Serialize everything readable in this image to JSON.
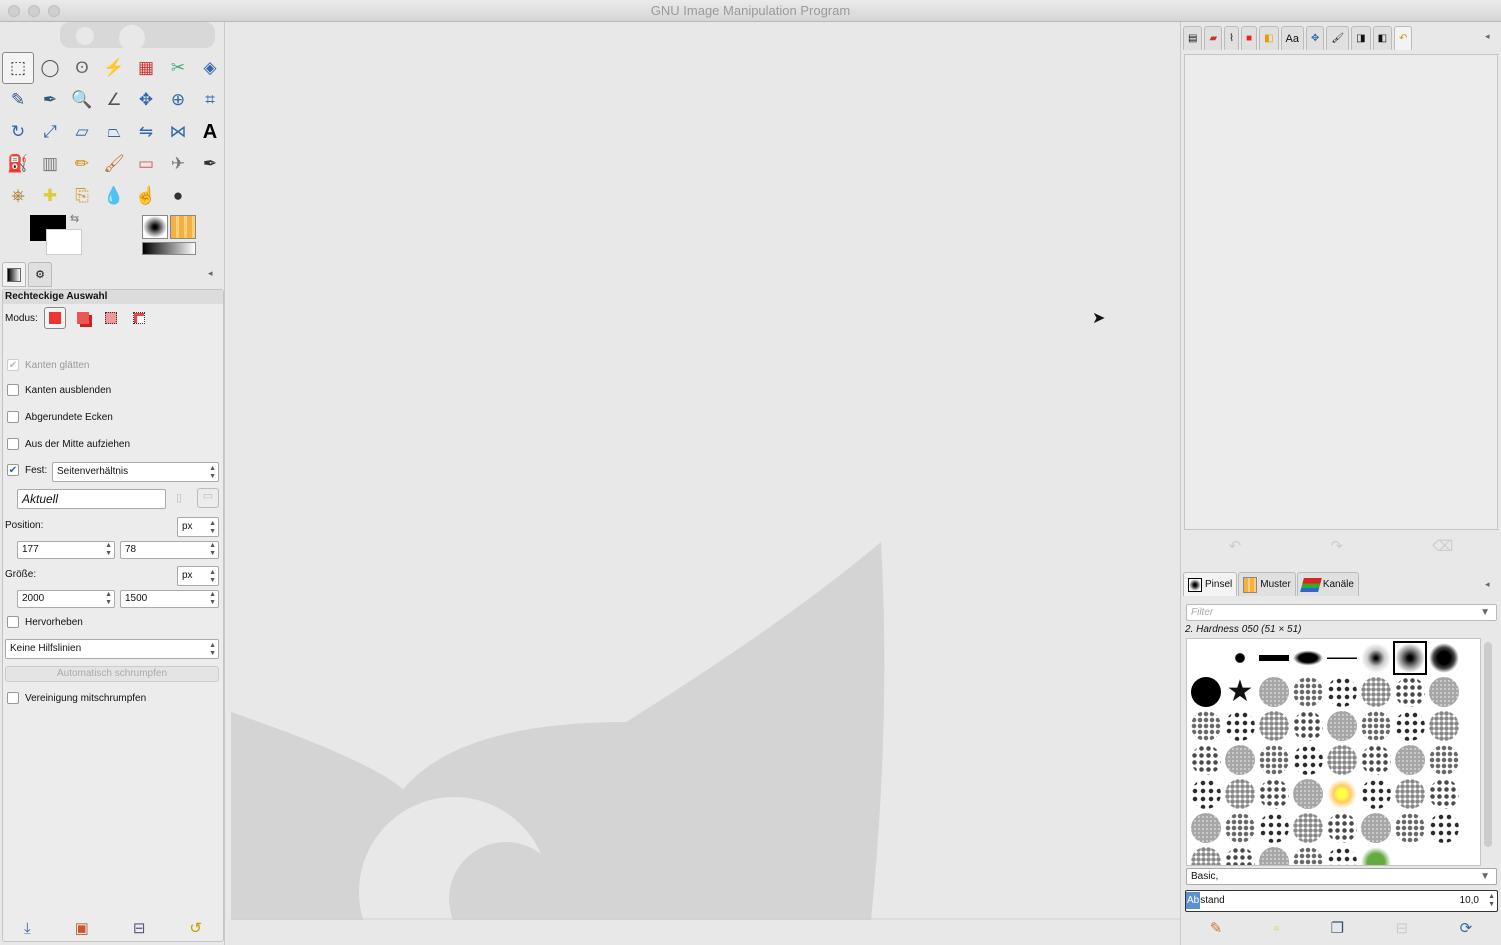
{
  "window": {
    "title": "GNU Image Manipulation Program"
  },
  "toolbox": {
    "tools": [
      "rect-select",
      "ellipse-select",
      "free-select",
      "fuzzy-select",
      "select-by-color",
      "scissors",
      "foreground-select",
      "paths",
      "color-picker",
      "zoom",
      "measure",
      "move",
      "align",
      "crop",
      "rotate",
      "scale",
      "shear",
      "perspective",
      "flip",
      "cage-transform",
      "text",
      "bucket-fill",
      "blend",
      "pencil",
      "paintbrush",
      "eraser",
      "airbrush",
      "ink",
      "clone",
      "heal",
      "perspective-clone",
      "blur",
      "smudge",
      "dodge-burn"
    ],
    "tool_glyphs": [
      "⬚",
      "◯",
      "ʘ",
      "⚡",
      "▦",
      "✂",
      "◈",
      "✎",
      "✒",
      "🔍",
      "∠",
      "✥",
      "⊕",
      "⌗",
      "↻",
      "⤢",
      "▱",
      "⏢",
      "⇋",
      "⋈",
      "A",
      "⛽",
      "▥",
      "✏",
      "🖌",
      "▭",
      "✈",
      "✒",
      "⎈",
      "✚",
      "⎘",
      "💧",
      "☝",
      "●"
    ],
    "tool_colors": [
      "#333",
      "#555",
      "#666",
      "#777",
      "#c33",
      "#4a7",
      "#36a",
      "#358",
      "#357",
      "#357",
      "#555",
      "#36a",
      "#36a",
      "#36a",
      "#36a",
      "#36a",
      "#36a",
      "#36a",
      "#36a",
      "#36a",
      "#000",
      "#36a",
      "#777",
      "#c80",
      "#b73",
      "#d55",
      "#777",
      "#333",
      "#a73",
      "#dc3",
      "#c93",
      "#69c",
      "#c96",
      "#333"
    ]
  },
  "options": {
    "title": "Rechteckige Auswahl",
    "mode_label": "Modus:",
    "antialias": "Kanten glätten",
    "feather": "Kanten ausblenden",
    "rounded": "Abgerundete Ecken",
    "from_center": "Aus der Mitte aufziehen",
    "fixed_label": "Fest:",
    "fixed_value": "Seitenverhältnis",
    "aspect_value": "Aktuell",
    "position_label": "Position:",
    "position_unit": "px",
    "pos_x": "177",
    "pos_y": "78",
    "size_label": "Größe:",
    "size_unit": "px",
    "size_w": "2000",
    "size_h": "1500",
    "highlight": "Hervorheben",
    "guides": "Keine Hilfslinien",
    "auto_shrink": "Automatisch schrumpfen",
    "shrink_merged": "Vereinigung mitschrumpfen"
  },
  "brushes": {
    "tabs": [
      "Pinsel",
      "Muster",
      "Kanäle"
    ],
    "filter_placeholder": "Filter",
    "selected": "2. Hardness 050 (51 × 51)",
    "tag": "Basic,",
    "spacing_label_hl": "Ab",
    "spacing_label": "stand",
    "spacing_value": "10,0"
  }
}
